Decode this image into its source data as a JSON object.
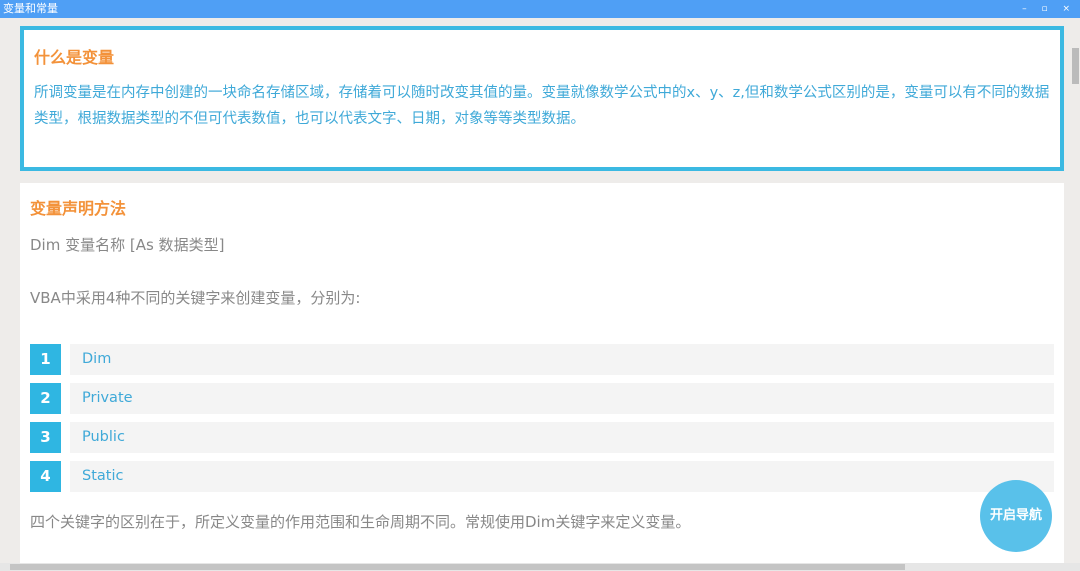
{
  "window": {
    "title": "变量和常量",
    "controls": "– ▫ ×"
  },
  "intro": {
    "heading": "什么是变量",
    "text": "所调变量是在内存中创建的一块命名存储区域，存储着可以随时改变其值的量。变量就像数学公式中的x、y、z,但和数学公式区别的是，变量可以有不同的数据类型，根据数据类型的不但可代表数值，也可以代表文字、日期，对象等等类型数据。"
  },
  "declare": {
    "heading": "变量声明方法",
    "syntax": "Dim 变量名称 [As 数据类型]",
    "lead": "VBA中采用4种不同的关键字来创建变量，分别为:",
    "items": [
      {
        "num": "1",
        "label": "Dim"
      },
      {
        "num": "2",
        "label": "Private"
      },
      {
        "num": "3",
        "label": "Public"
      },
      {
        "num": "4",
        "label": "Static"
      }
    ],
    "summary": "四个关键字的区别在于，所定义变量的作用范围和生命周期不同。常规使用Dim关键字来定义变量。"
  },
  "nav_button": "开启导航"
}
